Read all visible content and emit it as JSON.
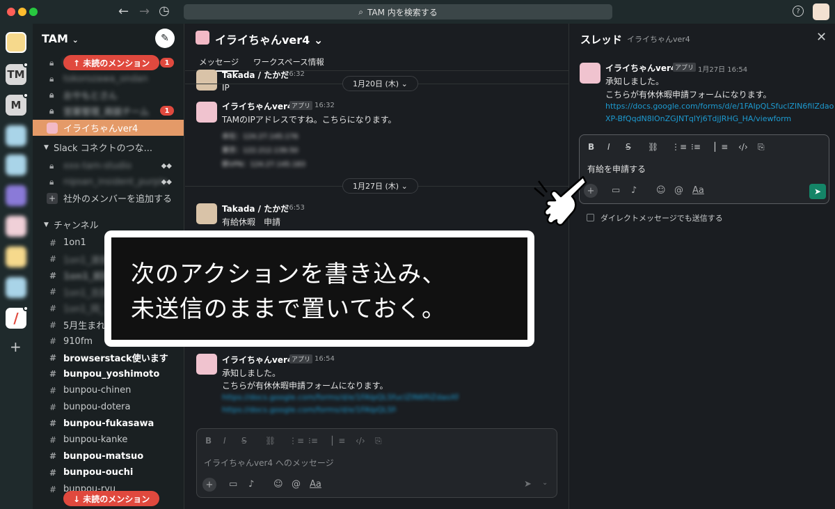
{
  "titlebar": {
    "search_placeholder": "TAM 内を検索する",
    "help": "?"
  },
  "rail": {
    "workspaces": [
      "TM",
      "M"
    ]
  },
  "sidebar": {
    "workspace": "TAM",
    "workspace_chevron": "⌄",
    "mention_top": "↑  未読のメンション",
    "mention_bottom": "↓  未読のメンション",
    "items": [
      {
        "label": "tokorozawa_zouen",
        "badge": "1"
      },
      {
        "label": "tokorozawa_ondan",
        "badge": ""
      },
      {
        "label": "おやもとさん",
        "badge": ""
      },
      {
        "label": "営業管理_商談チーム",
        "badge": "1"
      },
      {
        "label": "イライちゃんver4",
        "badge": ""
      }
    ],
    "connect_section": "Slack コネクトのつな...",
    "connect_items": [
      "xxx-tam-studio",
      "nipsan_insident_purple"
    ],
    "add_external": "社外のメンバーを追加する",
    "channels_section": "チャンネル",
    "channels": [
      {
        "name": "1on1",
        "bold": false,
        "blur": false
      },
      {
        "name": "1on1_渡部",
        "bold": false,
        "blur": true
      },
      {
        "name": "1on1_前田",
        "bold": true,
        "blur": true
      },
      {
        "name": "1on1_吉田",
        "bold": false,
        "blur": true
      },
      {
        "name": "1on1_岡_Ti",
        "bold": false,
        "blur": true
      },
      {
        "name": "5月生まれ",
        "bold": false,
        "blur": false
      },
      {
        "name": "910fm",
        "bold": false,
        "blur": false
      },
      {
        "name": "browserstack使います",
        "bold": true,
        "blur": false
      },
      {
        "name": "bunpou_yoshimoto",
        "bold": true,
        "blur": false
      },
      {
        "name": "bunpou-chinen",
        "bold": false,
        "blur": false
      },
      {
        "name": "bunpou-dotera",
        "bold": false,
        "blur": false
      },
      {
        "name": "bunpou-fukasawa",
        "bold": true,
        "blur": false
      },
      {
        "name": "bunpou-kanke",
        "bold": false,
        "blur": false
      },
      {
        "name": "bunpou-matsuo",
        "bold": true,
        "blur": false
      },
      {
        "name": "bunpou-ouchi",
        "bold": true,
        "blur": false
      },
      {
        "name": "bunpou-ryu",
        "bold": false,
        "blur": false
      }
    ]
  },
  "main": {
    "channel_title": "イライちゃんver4 ⌄",
    "tabs": [
      "メッセージ",
      "ワークスペース情報"
    ],
    "date1": "1月20日 (木) ⌄",
    "date2": "1月27日 (木) ⌄",
    "messages": [
      {
        "name": "Takada / たかだ",
        "time": "16:32",
        "text": "IP"
      },
      {
        "name": "イライちゃんver4",
        "tag": "アプリ",
        "time": "16:32",
        "text": "TAMのIPアドレスですね。こちらになります。"
      },
      {
        "name": "Takada / たかだ",
        "time": "16:53",
        "text": "有給休暇　申請"
      },
      {
        "name": "イライちゃんver4",
        "tag": "アプリ",
        "time": "16:54",
        "text1": "承知しました。",
        "text2": "こちらが有休休暇申請フォームになります。"
      }
    ],
    "blurred_ip": [
      "本社：124.27.145.176",
      "東京：122.212.139.50",
      "新VPN：124.27.145.183"
    ],
    "blurred_link": "https://docs.google.com/forms/d/e/1FAIpQLSfuclZIN6filZdaoXP-BfQqdN8IOnZGJNTqlYj6TdjJRHG_HA/viewform",
    "composer_placeholder": "イライちゃんver4 へのメッセージ"
  },
  "thread": {
    "title": "スレッド",
    "subtitle": "イライちゃんver4",
    "close": "✕",
    "name": "イライちゃんver4",
    "tag": "アプリ",
    "time": "1月27日 16:54",
    "text1": "承知しました。",
    "text2": "こちらが有休休暇申請フォームになります。",
    "link1": "https://docs.google.com/forms/d/e/1FAIpQLSfuclZIN6filZdao",
    "link2": "XP-BfQqdN8IOnZGJNTqlYj6TdjJRHG_HA/viewform",
    "input_value": "有給を申請する",
    "checkbox_label": "ダイレクトメッセージでも送信する"
  },
  "overlay": {
    "line1": "次のアクションを書き込み、",
    "line2": "未送信のままで置いておく。"
  },
  "colors": {
    "accent_active": "#e49a68",
    "badge": "#e0493e",
    "send": "#148567",
    "link": "#1d9bd1"
  }
}
